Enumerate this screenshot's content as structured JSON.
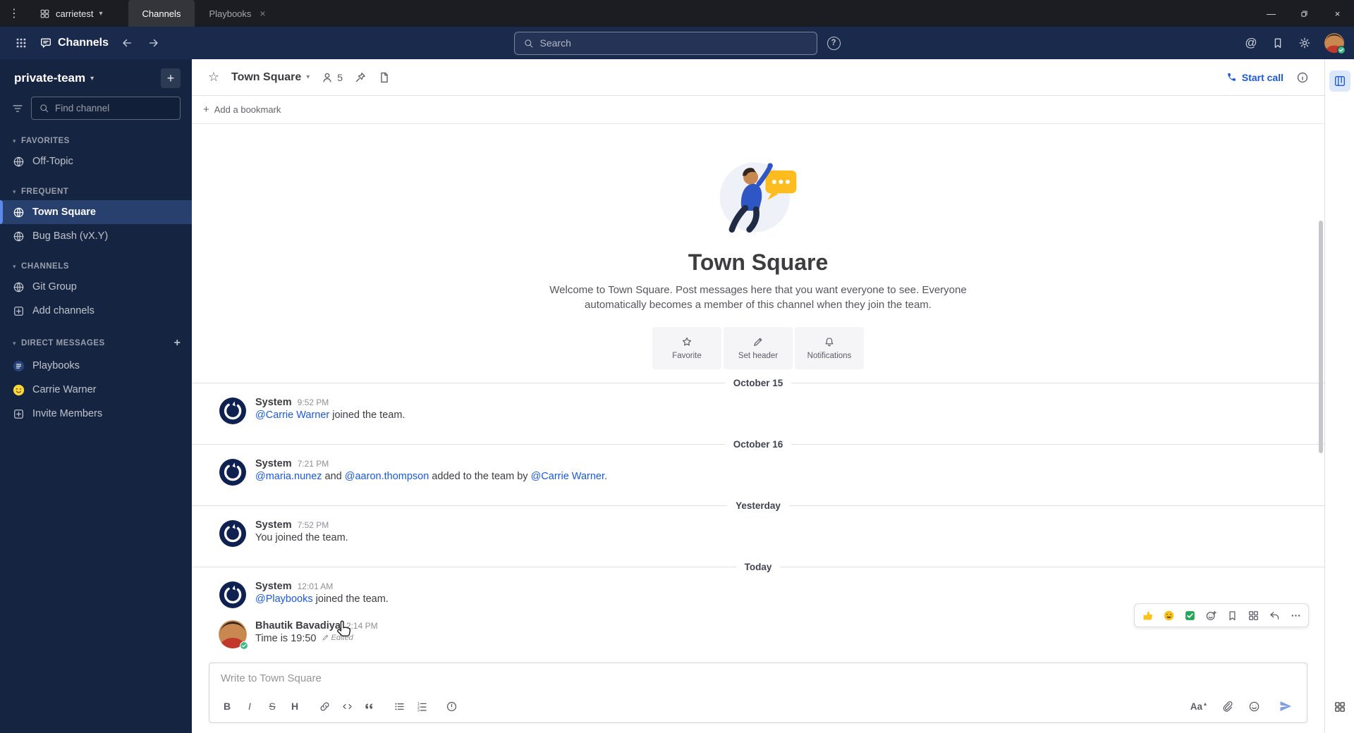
{
  "colors": {
    "accent": "#1c58d9",
    "link": "#1c58d9",
    "online": "#3db887",
    "header_bg": "#1a2a4d",
    "sidebar_bg": "#152440",
    "sidebar_active": "#28406e"
  },
  "icons": {
    "menu_dots": "⋮",
    "chevron_down": "▾",
    "caret_up": "▴",
    "close": "×",
    "minimize": "—",
    "star_outline": "☆",
    "help": "?",
    "at_mention": "@",
    "plus": "+",
    "bold": "B",
    "italic": "I",
    "strikethrough": "S",
    "heading": "H",
    "aa": "Aa"
  },
  "titlebar": {
    "server_name": "carrietest",
    "tabs": [
      {
        "label": "Channels",
        "active": true
      },
      {
        "label": "Playbooks",
        "active": false
      }
    ]
  },
  "global_header": {
    "product_name": "Channels",
    "search_placeholder": "Search"
  },
  "sidebar": {
    "team_name": "private-team",
    "find_channel_placeholder": "Find channel",
    "sections": [
      {
        "label": "FAVORITES",
        "has_add": false,
        "items": [
          {
            "label": "Off-Topic",
            "icon": "globe",
            "active": false
          }
        ]
      },
      {
        "label": "FREQUENT",
        "has_add": false,
        "items": [
          {
            "label": "Town Square",
            "icon": "globe",
            "active": true
          },
          {
            "label": "Bug Bash (vX.Y)",
            "icon": "globe",
            "active": false
          }
        ]
      },
      {
        "label": "CHANNELS",
        "has_add": false,
        "items": [
          {
            "label": "Git Group",
            "icon": "globe",
            "active": false
          },
          {
            "label": "Add channels",
            "icon": "add",
            "active": false
          }
        ]
      },
      {
        "label": "DIRECT MESSAGES",
        "has_add": true,
        "items": [
          {
            "label": "Playbooks",
            "icon": "playbooks",
            "active": false
          },
          {
            "label": "Carrie Warner",
            "icon": "avatar",
            "active": false
          },
          {
            "label": "Invite Members",
            "icon": "add",
            "active": false
          }
        ]
      }
    ]
  },
  "channel_header": {
    "name": "Town Square",
    "member_count": "5",
    "start_call_label": "Start call"
  },
  "bookmark_bar": {
    "label": "Add a bookmark"
  },
  "intro": {
    "title": "Town Square",
    "description": "Welcome to Town Square. Post messages here that you want everyone to see. Everyone automatically becomes a member of this channel when they join the team.",
    "actions": [
      {
        "label": "Favorite",
        "icon": "star"
      },
      {
        "label": "Set header",
        "icon": "pencil"
      },
      {
        "label": "Notifications",
        "icon": "bell"
      }
    ]
  },
  "feed": [
    {
      "type": "divider",
      "label": "October 15"
    },
    {
      "type": "message",
      "sender": "System",
      "time": "9:52 PM",
      "avatar": "system",
      "parts": [
        {
          "text": "@Carrie Warner",
          "link": true
        },
        {
          "text": " joined the team.",
          "link": false
        }
      ]
    },
    {
      "type": "divider",
      "label": "October 16"
    },
    {
      "type": "message",
      "sender": "System",
      "time": "7:21 PM",
      "avatar": "system",
      "parts": [
        {
          "text": "@maria.nunez",
          "link": true
        },
        {
          "text": " and ",
          "link": false
        },
        {
          "text": "@aaron.thompson",
          "link": true
        },
        {
          "text": " added to the team by ",
          "link": false
        },
        {
          "text": "@Carrie Warner",
          "link": true
        },
        {
          "text": ".",
          "link": false
        }
      ]
    },
    {
      "type": "divider",
      "label": "Yesterday"
    },
    {
      "type": "message",
      "sender": "System",
      "time": "7:52 PM",
      "avatar": "system",
      "parts": [
        {
          "text": "You joined the team.",
          "link": false
        }
      ]
    },
    {
      "type": "divider",
      "label": "Today"
    },
    {
      "type": "message",
      "sender": "System",
      "time": "12:01 AM",
      "avatar": "system",
      "parts": [
        {
          "text": "@Playbooks",
          "link": true
        },
        {
          "text": " joined the team.",
          "link": false
        }
      ]
    },
    {
      "type": "message",
      "sender": "Bhautik Bavadiya",
      "time": "2:14 PM",
      "avatar": "user",
      "hover_actions": true,
      "parts": [
        {
          "text": "Time is 19:50",
          "link": false
        }
      ],
      "edited_label": "Edited"
    }
  ],
  "message_actions": {
    "reactions": [
      "thumbs-up",
      "smiley",
      "check-mark"
    ],
    "actions": [
      "add-reaction",
      "save-message",
      "message-menu",
      "reply",
      "more-actions"
    ]
  },
  "composer": {
    "placeholder": "Write to Town Square",
    "format_tools": [
      "bold",
      "italic",
      "strikethrough",
      "heading",
      "link",
      "code",
      "quote",
      "bullet-list",
      "ordered-list",
      "priority"
    ]
  }
}
